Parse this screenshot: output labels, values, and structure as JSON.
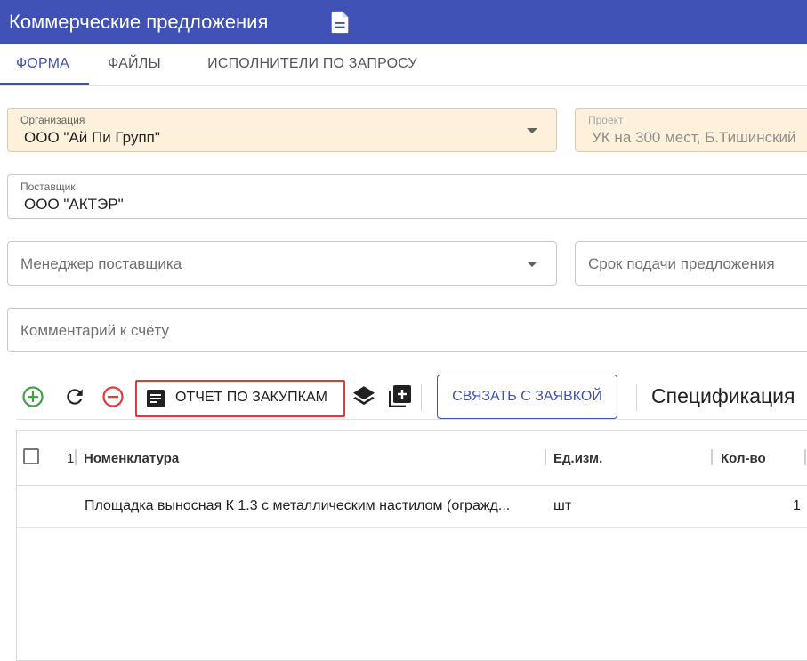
{
  "header": {
    "title": "Коммерческие предложения",
    "icon": "document-icon"
  },
  "tabs": [
    {
      "label": "ФОРМА",
      "active": true
    },
    {
      "label": "ФАЙЛЫ",
      "active": false
    },
    {
      "label": "ИСПОЛНИТЕЛИ ПО ЗАПРОСУ",
      "active": false
    }
  ],
  "form": {
    "organization": {
      "label": "Организация",
      "value": "ООО \"Ай Пи Групп\""
    },
    "project": {
      "label": "Проект",
      "value": "УК на 300 мест, Б.Тишинский"
    },
    "supplier": {
      "label": "Поставщик",
      "value": "ООО \"АКТЭР\""
    },
    "supplier_manager": {
      "placeholder": "Менеджер поставщика"
    },
    "deadline": {
      "placeholder": "Срок подачи предложения"
    },
    "comment": {
      "placeholder": "Комментарий к счёту"
    }
  },
  "toolbar": {
    "report_label": "ОТЧЕТ ПО ЗАКУПКАМ",
    "link_label": "СВЯЗАТЬ С ЗАЯВКОЙ",
    "spec_title": "Спецификация"
  },
  "grid": {
    "row_number_header": "1",
    "columns": [
      "Номенклатура",
      "Ед.изм.",
      "Кол-во"
    ],
    "rows": [
      {
        "name": "Площадка выносная К 1.3 с металлическим настилом (огражд...",
        "unit": "шт",
        "qty": "1"
      }
    ]
  },
  "colors": {
    "primary": "#3f51b5",
    "add": "#43a047",
    "remove": "#e53935",
    "filled_field": "#fdf1dc"
  }
}
